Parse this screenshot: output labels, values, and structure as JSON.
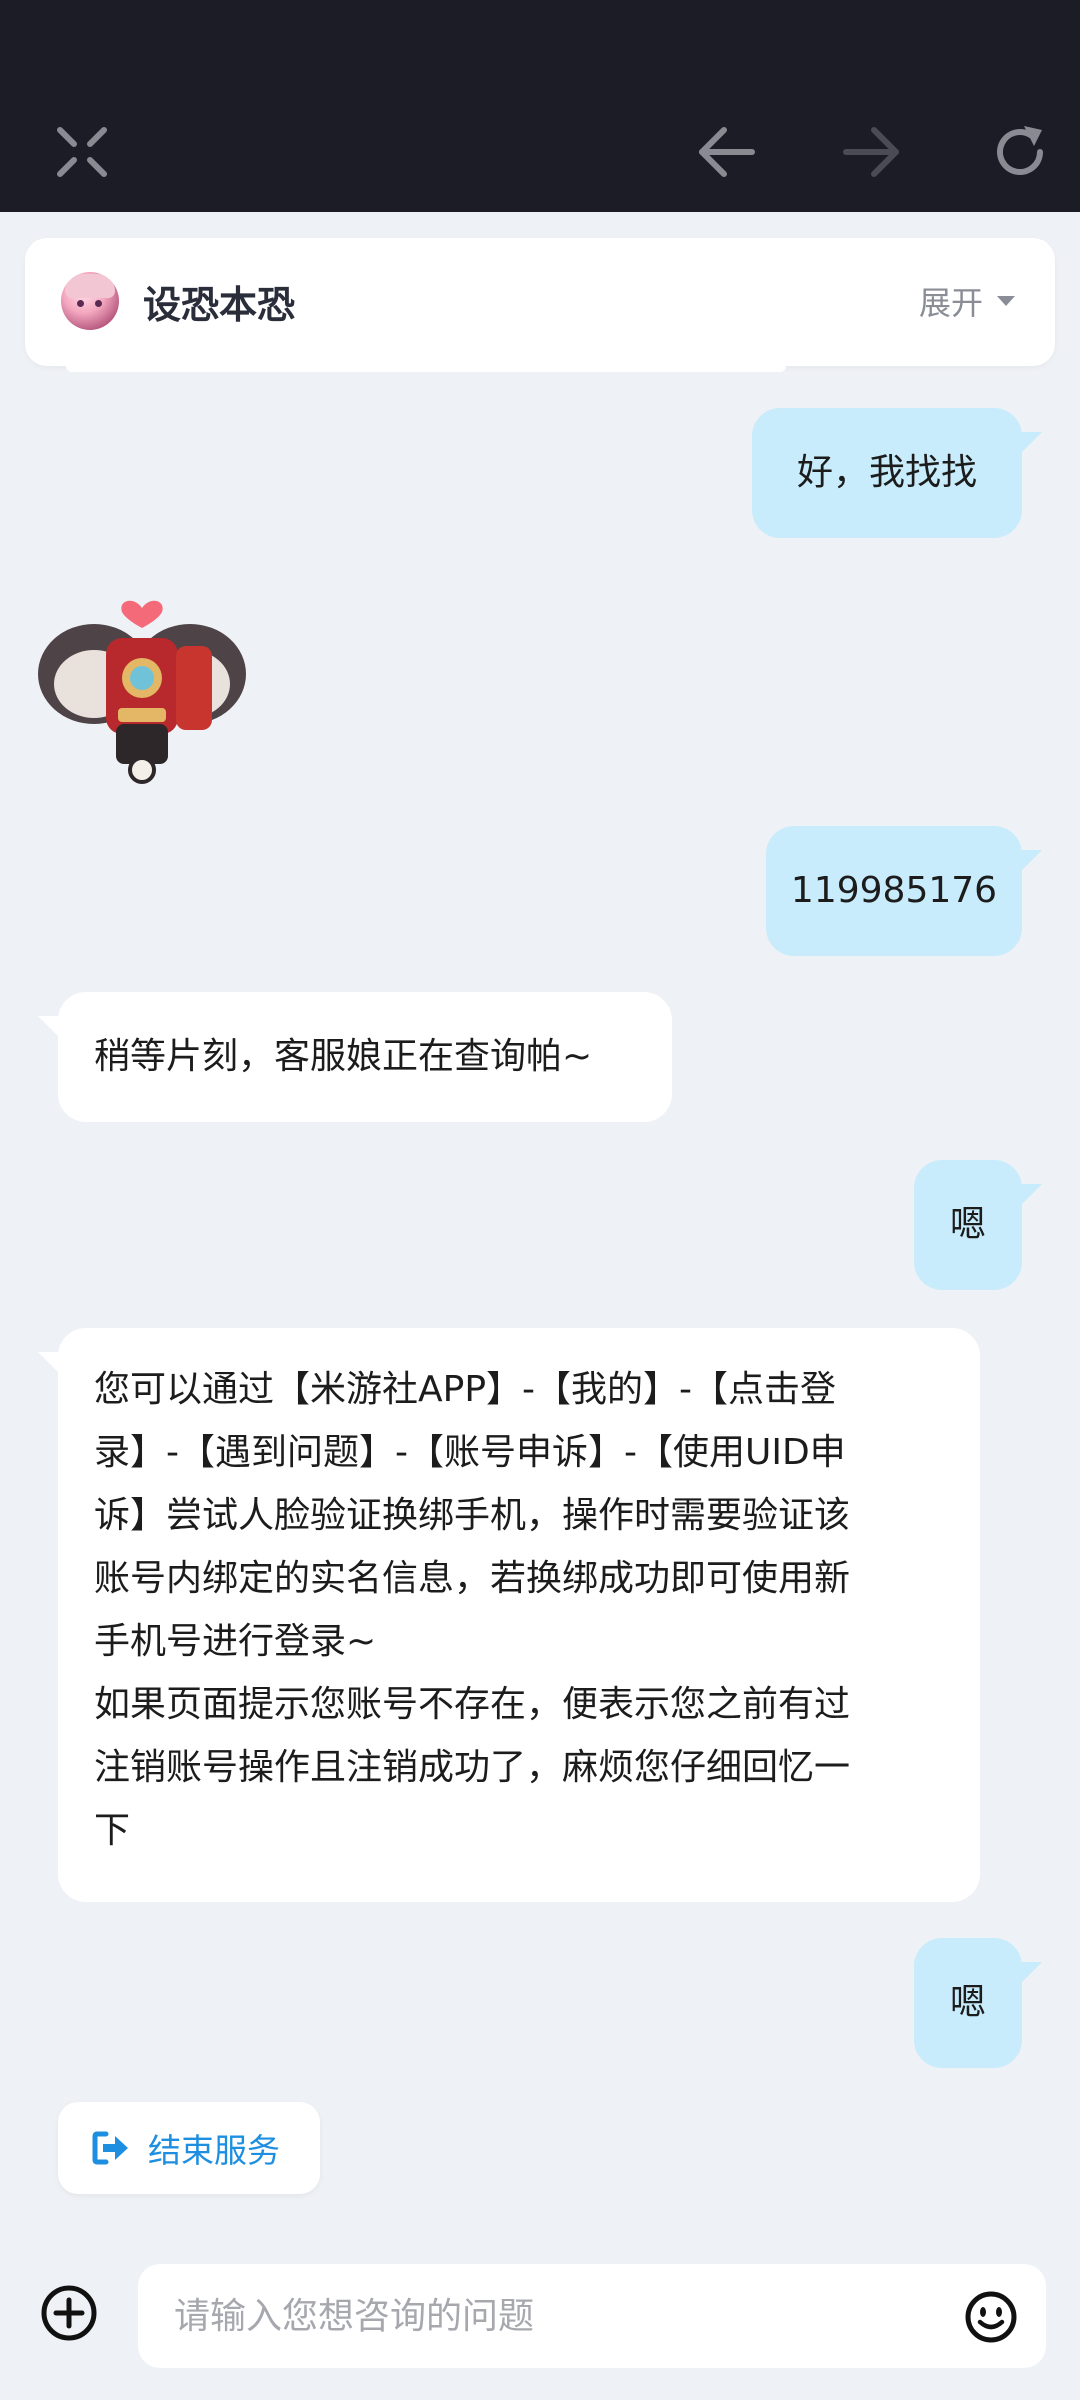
{
  "topbar": {
    "icons": [
      "close-icon",
      "back-arrow-icon",
      "forward-arrow-icon",
      "refresh-icon"
    ]
  },
  "header": {
    "name": "设恐本恐",
    "expand_label": "展开"
  },
  "messages": [
    {
      "from": "me",
      "text": "好，我找找"
    },
    {
      "from": "them",
      "type": "sticker"
    },
    {
      "from": "me",
      "text": "119985176"
    },
    {
      "from": "them",
      "text": "稍等片刻，客服娘正在查询帕~"
    },
    {
      "from": "me",
      "text": "嗯"
    },
    {
      "from": "them",
      "lines": [
        "您可以通过【米游社APP】-【我的】-【点击登",
        "录】-【遇到问题】-【账号申诉】-【使用UID申",
        "诉】尝试人脸验证换绑手机，操作时需要验证该",
        "账号内绑定的实名信息，若换绑成功即可使用新",
        "手机号进行登录~",
        "如果页面提示您账号不存在，便表示您之前有过",
        "注销账号操作且注销成功了，麻烦您仔细回忆一",
        "下"
      ]
    },
    {
      "from": "me",
      "text": "嗯"
    }
  ],
  "end_service": {
    "label": "结束服务",
    "color": "#1e8fe0"
  },
  "composer": {
    "placeholder": "请输入您想咨询的问题"
  },
  "colors": {
    "topbar_bg": "#1b1c26",
    "page_bg": "#eef1f5",
    "my_bubble": "#c8ecfb",
    "their_bubble": "#ffffff"
  }
}
